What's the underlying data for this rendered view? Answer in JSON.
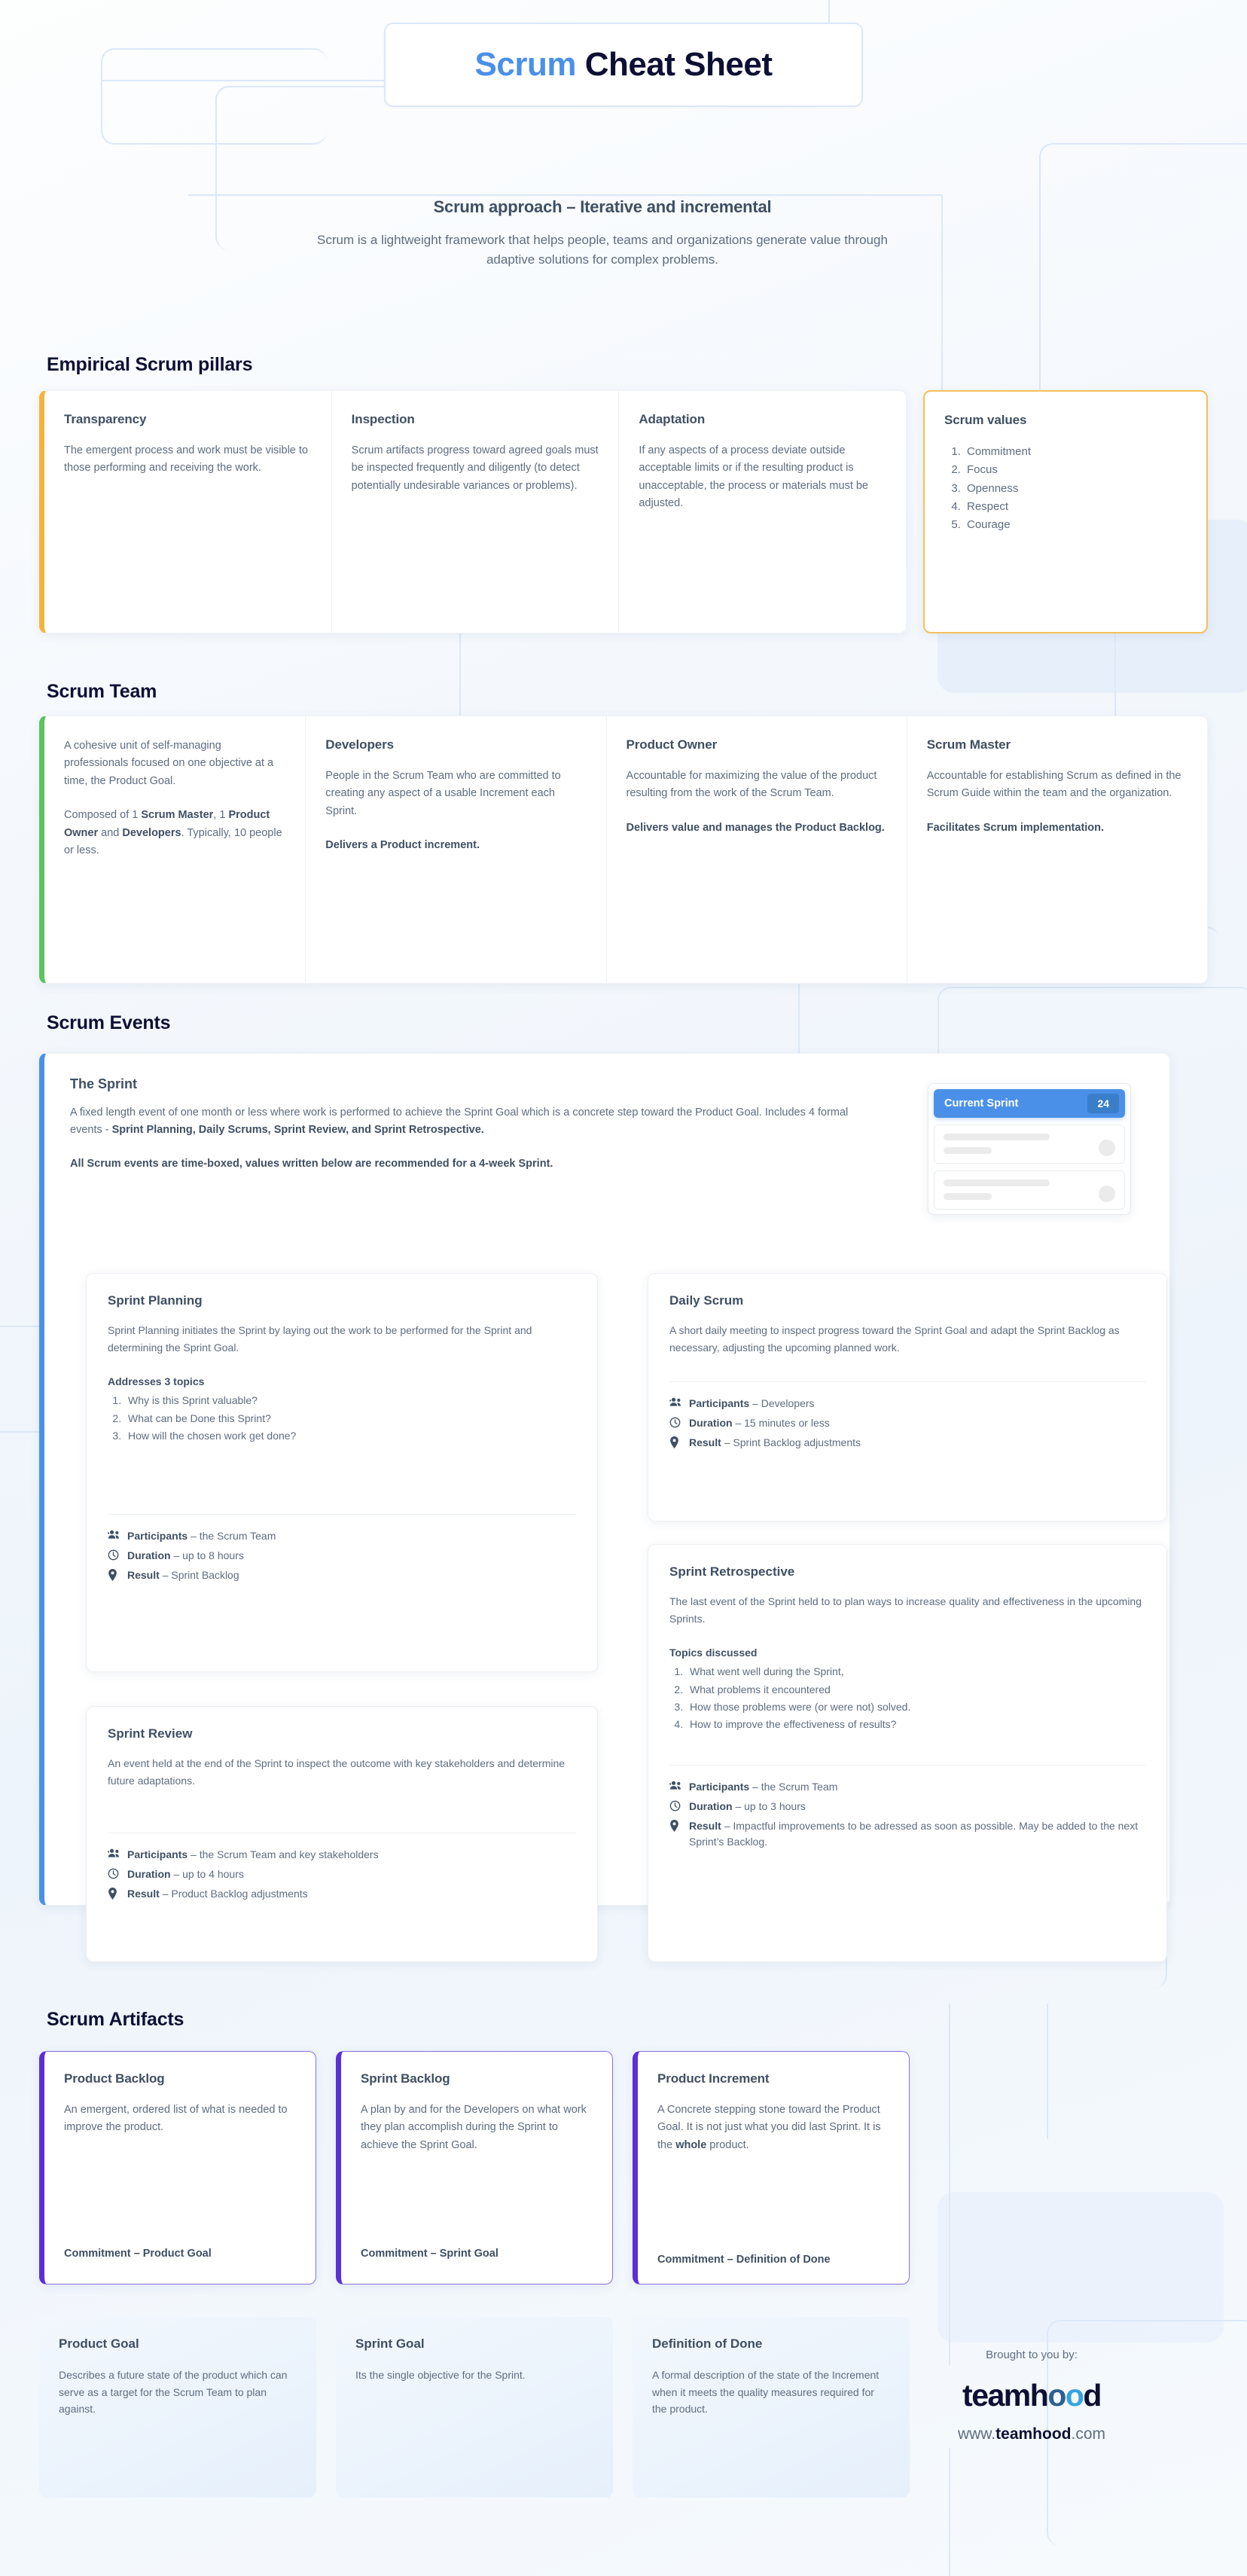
{
  "header": {
    "title_accent": "Scrum",
    "title_rest": "Cheat Sheet"
  },
  "intro": {
    "heading": "Scrum approach – Iterative and incremental",
    "body": "Scrum is a lightweight framework that helps people, teams and organizations generate value through adaptive solutions for complex problems."
  },
  "sections": {
    "pillars": "Empirical Scrum pillars",
    "team": "Scrum Team",
    "events": "Scrum Events",
    "artifacts": "Scrum Artifacts"
  },
  "pillars": [
    {
      "title": "Transparency",
      "body": "The emergent process and work must be visible to those performing and receiving the work."
    },
    {
      "title": "Inspection",
      "body": "Scrum artifacts progress toward agreed goals must be inspected frequently and diligently (to detect potentially undesirable variances or problems)."
    },
    {
      "title": "Adaptation",
      "body": "If any aspects of a process deviate outside acceptable limits or if the resulting product is unacceptable, the process or materials must be adjusted."
    }
  ],
  "scrum_values": {
    "title": "Scrum values",
    "items": [
      "Commitment",
      "Focus",
      "Openness",
      "Respect",
      "Courage"
    ]
  },
  "team": {
    "intro_p1": "A cohesive unit of self-managing professionals focused on one objective at a time, the Product Goal.",
    "intro_p2_html": "Composed of 1 <b>Scrum Master</b>, 1 <b>Product Owner</b> and <b>Developers</b>. Typically, 10 people or less.",
    "roles": [
      {
        "title": "Developers",
        "body": "People in the Scrum Team who are committed to creating any aspect of a usable Increment each Sprint.",
        "note": "Delivers a Product increment."
      },
      {
        "title": "Product Owner",
        "body": "Accountable for maximizing the value of the product resulting from the work of the Scrum Team.",
        "note": "Delivers value and manages the Product Backlog."
      },
      {
        "title": "Scrum Master",
        "body": "Accountable for establishing Scrum as defined in the Scrum Guide within the team and the organization.",
        "note": "Facilitates Scrum implementation."
      }
    ]
  },
  "sprint": {
    "title": "The Sprint",
    "body_html": "A fixed length event of one month or less where work is performed to achieve the Sprint Goal which is a concrete step toward the Product Goal. Includes 4 formal events - <b>Sprint Planning, Daily Scrums, Sprint Review, and Sprint Retrospective.</b>",
    "timebox_note": "All Scrum events are time-boxed, values written below are recommended for a 4-week Sprint."
  },
  "kanban": {
    "column_title": "Current Sprint",
    "count": "24"
  },
  "events": [
    {
      "title": "Sprint Planning",
      "body": "Sprint Planning initiates the Sprint by laying out the work to be performed for the Sprint and determining the Sprint Goal.",
      "subhead": "Addresses 3 topics",
      "topics": [
        "Why is this Sprint valuable?",
        "What can be Done this Sprint?",
        "How will the chosen work get done?"
      ],
      "participants_label": "Participants",
      "participants_value": "– the Scrum Team",
      "duration_label": "Duration",
      "duration_value": "– up to 8 hours",
      "result_label": "Result",
      "result_value": "– Sprint Backlog"
    },
    {
      "title": "Daily Scrum",
      "body": "A short daily meeting to inspect progress toward the Sprint Goal and adapt the Sprint Backlog as necessary, adjusting the upcoming planned work.",
      "subhead": "",
      "topics": [],
      "participants_label": "Participants",
      "participants_value": "– Developers",
      "duration_label": "Duration",
      "duration_value": "– 15 minutes or less",
      "result_label": "Result",
      "result_value": "– Sprint Backlog adjustments"
    },
    {
      "title": "Sprint Review",
      "body": "An event held at the end of the Sprint to inspect the outcome with key stakeholders and determine future adaptations.",
      "subhead": "",
      "topics": [],
      "participants_label": "Participants",
      "participants_value": "– the Scrum Team and key stakeholders",
      "duration_label": "Duration",
      "duration_value": "– up to 4 hours",
      "result_label": "Result",
      "result_value": "– Product Backlog adjustments"
    },
    {
      "title": "Sprint Retrospective",
      "body": "The last event of the Sprint held to to plan ways to increase quality and effectiveness in the upcoming Sprints.",
      "subhead": "Topics discussed",
      "topics": [
        "What went well during the Sprint,",
        "What problems it encountered",
        "How those problems were (or were not) solved.",
        "How to improve the effectiveness of results?"
      ],
      "participants_label": "Participants",
      "participants_value": "– the Scrum Team",
      "duration_label": "Duration",
      "duration_value": "– up to 3 hours",
      "result_label": "Result",
      "result_value": "– Impactful improvements to be adressed as soon as possible. May be added to the next Sprint’s Backlog."
    }
  ],
  "artifacts": [
    {
      "title": "Product Backlog",
      "body_html": "An emergent, ordered list of what is needed to improve the product.",
      "commitment": "Commitment – Product Goal"
    },
    {
      "title": "Sprint Backlog",
      "body_html": "A plan by and for the Developers on what work they plan accomplish during the Sprint to achieve the Sprint Goal.",
      "commitment": "Commitment – Sprint Goal"
    },
    {
      "title": "Product Increment",
      "body_html": "A Concrete stepping stone toward the Product Goal. It is not just what you did last Sprint. It is the <b>whole</b> product.",
      "commitment": "Commitment – Definition of Done"
    }
  ],
  "goals": [
    {
      "title": "Product Goal",
      "body": "Describes a future state of the product which can serve as a target for the  Scrum Team to plan against."
    },
    {
      "title": "Sprint Goal",
      "body": "Its the single objective for the Sprint."
    },
    {
      "title": "Definition of Done",
      "body": "A formal description of the state of the Increment when it meets the  quality measures required for the product."
    }
  ],
  "footer": {
    "brought_by": "Brought to you by:",
    "logo_part1": "teamh",
    "logo_o1": "o",
    "logo_o2": "o",
    "logo_part2": "d",
    "url_prefix": "www.",
    "url_brand": "teamhood",
    "url_suffix": ".com"
  },
  "colors": {
    "accent_blue": "#4a90e8",
    "amber": "#f5b33c",
    "green": "#5ec25e",
    "purple": "#5b2fd6",
    "dark": "#0d1033",
    "body_text": "#5d6d80"
  }
}
